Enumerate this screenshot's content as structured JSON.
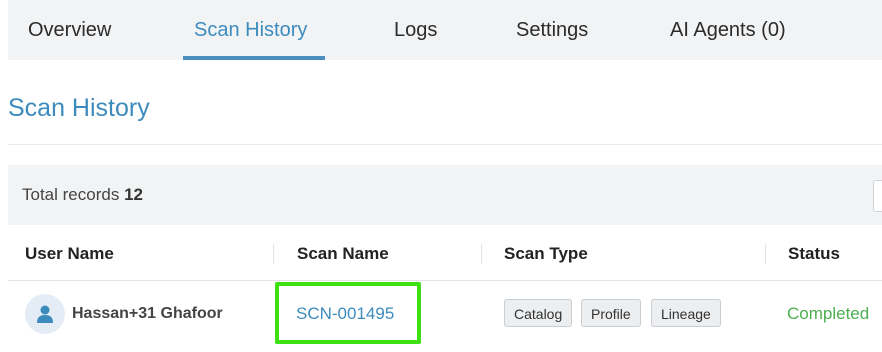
{
  "tabs": [
    {
      "label": "Overview",
      "active": false
    },
    {
      "label": "Scan History",
      "active": true
    },
    {
      "label": "Logs",
      "active": false
    },
    {
      "label": "Settings",
      "active": false
    },
    {
      "label": "AI Agents (0)",
      "active": false
    }
  ],
  "page_title": "Scan History",
  "records": {
    "label": "Total records",
    "count": "12"
  },
  "table": {
    "columns": [
      "User Name",
      "Scan Name",
      "Scan Type",
      "Status"
    ],
    "rows": [
      {
        "user": "Hassan+31 Ghafoor",
        "avatar_icon": "user-icon",
        "scan_name": "SCN-001495",
        "scan_types": [
          "Catalog",
          "Profile",
          "Lineage"
        ],
        "status": "Completed"
      }
    ]
  },
  "colors": {
    "accent": "#3d8bbd",
    "status_completed": "#4caf50",
    "highlight": "#3ee011"
  }
}
